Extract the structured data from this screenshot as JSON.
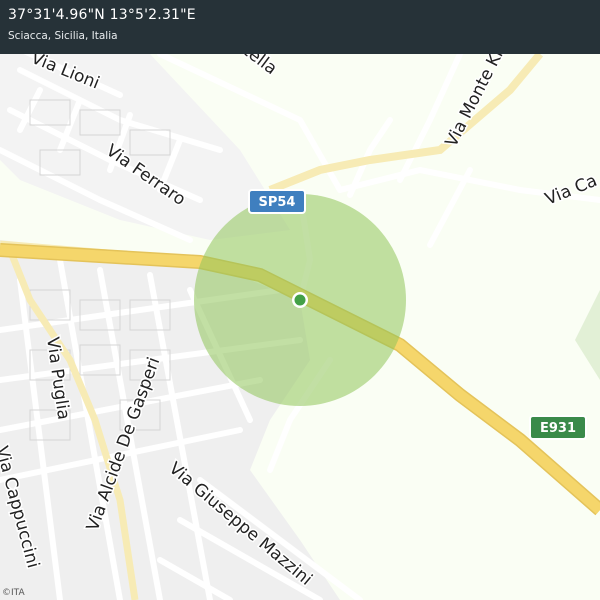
{
  "header": {
    "coordinates": "37°31'4.96\"N 13°5'2.31\"E",
    "place": "Sciacca, Sicilia, Italia"
  },
  "map": {
    "street_labels": [
      "Via Lioni",
      "Via Montella",
      "Via Monte Kron",
      "Via Ferraro",
      "Via Ca",
      "Via Puglia",
      "Via Alcide De Gasperi",
      "Via Giuseppe Mazzini",
      "Via Cappuccini"
    ],
    "road_shields": [
      "SP54",
      "E931"
    ],
    "location_marker": "current-location",
    "accuracy_color": "#9ccc65",
    "marker_color": "#43a047",
    "primary_road_color": "#f5d66b"
  },
  "attribution": "©ITA"
}
